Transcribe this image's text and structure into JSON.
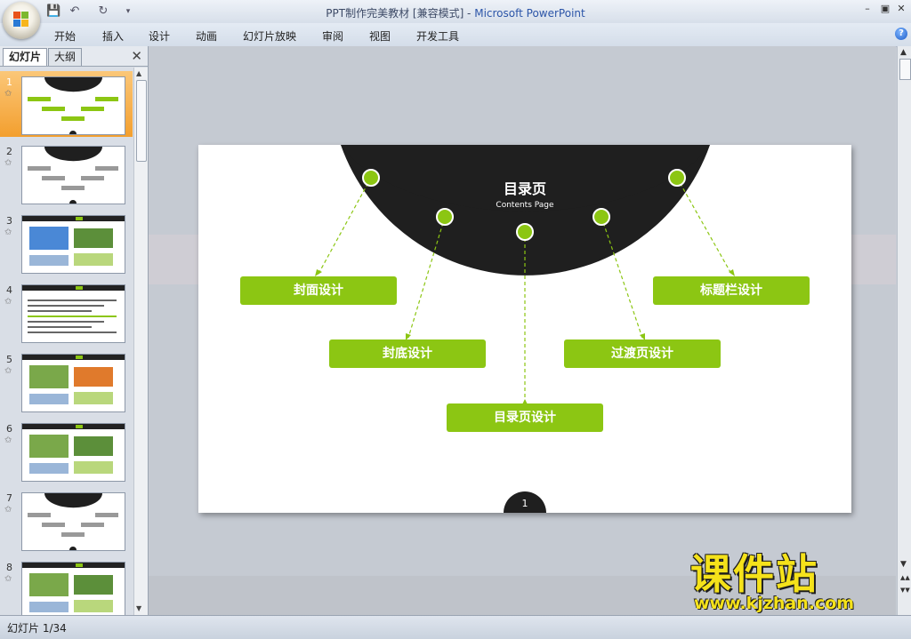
{
  "window": {
    "title_doc": "PPT制作完美教材 [兼容模式] - ",
    "title_app": "Microsoft PowerPoint",
    "controls": {
      "minimize": "–",
      "restore": "▣",
      "close": "✕"
    }
  },
  "quick_access": {
    "save_icon": "💾",
    "undo_icon": "↶",
    "redo_icon": "↻",
    "more_icon": "▾"
  },
  "ribbon": {
    "tabs": [
      "开始",
      "插入",
      "设计",
      "动画",
      "幻灯片放映",
      "审阅",
      "视图",
      "开发工具"
    ],
    "help_icon": "?"
  },
  "left_panel": {
    "tab_slides": "幻灯片",
    "tab_outline": "大纲",
    "close_icon": "✕",
    "thumbnails": [
      {
        "number": "1",
        "star": "✩"
      },
      {
        "number": "2",
        "star": "✩"
      },
      {
        "number": "3",
        "star": "✩"
      },
      {
        "number": "4",
        "star": "✩"
      },
      {
        "number": "5",
        "star": "✩"
      },
      {
        "number": "6",
        "star": "✩"
      },
      {
        "number": "7",
        "star": "✩"
      },
      {
        "number": "8",
        "star": "✩"
      }
    ],
    "selected_index": 0
  },
  "slide": {
    "title": "目录页",
    "subtitle": "Contents Page",
    "page_number": "1",
    "items": {
      "cover": "封面设计",
      "back_cover": "封底设计",
      "contents": "目录页设计",
      "transition": "过渡页设计",
      "title_bar": "标题栏设计"
    },
    "accent_color": "#8cc613",
    "dark_color": "#1f1f1f"
  },
  "scrollbar": {
    "up": "▲",
    "down": "▼",
    "prev": "▲▲",
    "next": "▼▼"
  },
  "status_bar": {
    "text": "幻灯片 1/34"
  },
  "watermark": {
    "brand": "课件站",
    "url": "www.kjzhan.com"
  }
}
